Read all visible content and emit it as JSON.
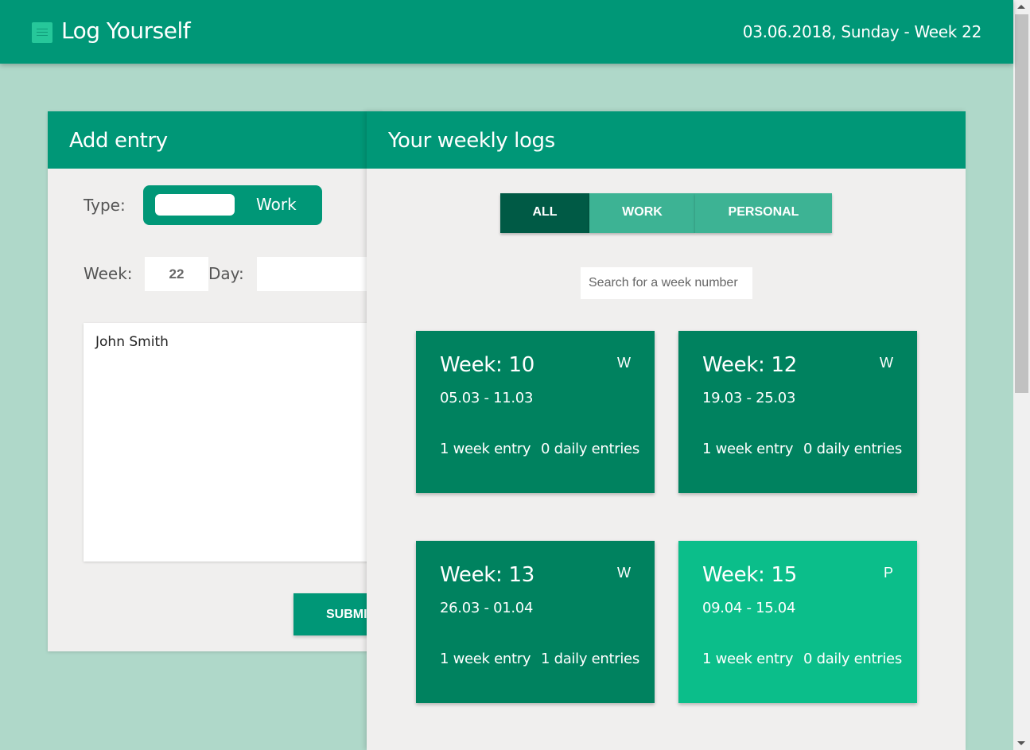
{
  "header": {
    "title": "Log Yourself",
    "date": "03.06.2018, Sunday - Week 22",
    "logo_icon": "notebook-icon",
    "color": "#009777"
  },
  "add_entry": {
    "title": "Add entry",
    "type_label": "Type:",
    "type_value": "Work",
    "week_label": "Week:",
    "week_value": "22",
    "day_label": "Day:",
    "day_value": "",
    "text_value": "John Smith",
    "submit_label": "SUBMIT"
  },
  "logs": {
    "title": "Your weekly logs",
    "tabs": [
      {
        "label": "ALL",
        "active": true
      },
      {
        "label": "WORK",
        "active": false
      },
      {
        "label": "PERSONAL",
        "active": false
      }
    ],
    "search_placeholder": "Search for a week number",
    "cards": [
      {
        "title": "Week: 10",
        "badge": "W",
        "range": "05.03 - 11.03",
        "week_entries": "1 week entry",
        "daily_entries": "0 daily entries",
        "color": "#00825f"
      },
      {
        "title": "Week: 12",
        "badge": "W",
        "range": "19.03 - 25.03",
        "week_entries": "1 week entry",
        "daily_entries": "0 daily entries",
        "color": "#00825f"
      },
      {
        "title": "Week: 13",
        "badge": "W",
        "range": "26.03 - 01.04",
        "week_entries": "1 week entry",
        "daily_entries": "1 daily entries",
        "color": "#00825f"
      },
      {
        "title": "Week: 15",
        "badge": "P",
        "range": "09.04 - 15.04",
        "week_entries": "1 week entry",
        "daily_entries": "0 daily entries",
        "color": "#0bbe8a"
      }
    ]
  }
}
